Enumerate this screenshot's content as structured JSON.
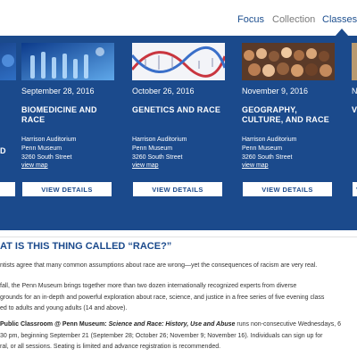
{
  "nav": {
    "items": [
      {
        "label": "Focus"
      },
      {
        "label": "Collection"
      },
      {
        "label": "Classes"
      }
    ]
  },
  "cards": [
    {
      "date": "",
      "title": "D",
      "venue": "",
      "building": "",
      "street": "",
      "link": "",
      "button": ""
    },
    {
      "date": "September 28, 2016",
      "title": "BIOMEDICINE AND RACE",
      "venue": "Harrison Auditorium",
      "building": "Penn Museum",
      "street": "3260 South Street",
      "link": "view map",
      "button": "VIEW DETAILS"
    },
    {
      "date": "October 26, 2016",
      "title": "GENETICS AND RACE",
      "venue": "Harrison Auditorium",
      "building": "Penn Museum",
      "street": "3260 South Street",
      "link": "view map",
      "button": "VIEW DETAILS"
    },
    {
      "date": "November 9, 2016",
      "title": "GEOGRAPHY, CULTURE, AND RACE",
      "venue": "Harrison Auditorium",
      "building": "Penn Museum",
      "street": "3260 South Street",
      "link": "view map",
      "button": "VIEW DETAILS"
    },
    {
      "date": "N",
      "title": "V",
      "venue": "",
      "building": "",
      "street": "",
      "link": "",
      "button": "V"
    }
  ],
  "intro": {
    "heading": "AT IS THIS THING CALLED “RACE?”",
    "p1": "ntists agree that many common assumptions about race are wrong—yet the consequences of racism are very real.",
    "p2_line1": "fall, the Penn Museum brings together more than two dozen internationally recognized experts from diverse",
    "p2_line2": "grounds for an in-depth and powerful exploration about race, science, and justice in a free series of five evening class",
    "p2_line3": "ed to adults and young adults (14 and above).",
    "p3_bold": "Public Classroom @ Penn Museum: ",
    "p3_italic": "Science and Race: History, Use and Abuse",
    "p3_rest": " runs non-consecutive Wednesdays, 6",
    "p3_line2": "30 pm, beginning September 21 (September 28; October 26; November 9; November 16). Individuals can sign up for",
    "p3_line3": "ral, or all sessions. Seating is limited and advance registration is recommended."
  },
  "colors": {
    "band": "#1b4a8c",
    "accent": "#1d4f8f"
  }
}
